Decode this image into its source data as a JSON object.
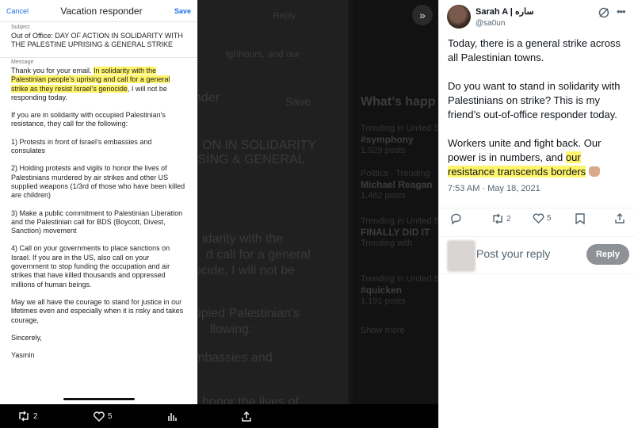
{
  "responder": {
    "cancel_label": "Cancel",
    "title": "Vacation responder",
    "save_label": "Save",
    "subject_label": "Subject",
    "subject": "Out of Office: DAY OF ACTION IN SOLIDARITY WITH THE PALESTINE UPRISING & GENERAL STRIKE",
    "message_label": "Message",
    "p1_pre": "Thank you for your email. ",
    "p1_hl": "In solidarity with the Palestinian people’s uprising and call for a general strike as they resist Israel’s genocide",
    "p1_post": ", I will not be responding today.",
    "p2": "If you are in solidarity with occupied Palestinian’s resistance, they call for the following:",
    "p3": "1) Protests in front of Israel’s embassies and consulates",
    "p4": "2) Holding protests and vigils to honor the lives of Palestinians murdered by air strikes and other US supplied weapons (1/3rd of those who have been killed are children)",
    "p5": "3) Make a public commitment to Palestinian Liberation and the Palestinian call for BDS (Boycott, Divest, Sanction) movement",
    "p6": "4) Call on your governments to place sanctions on Israel. If you are in the US, also call on your government to stop funding the occupation and air strikes that have killed thousands and oppressed millions of human beings.",
    "p7": "May we all have the courage to stand for justice in our lifetimes even and especially when it is risky and takes courage,",
    "p8": "Sincerely,",
    "p9": "Yasmin"
  },
  "background": {
    "reply": "Reply",
    "save": "Save",
    "bg_lines": [
      "ighhours, and our",
      "nder",
      "ON IN SOLIDARITY",
      "ISING & GENERAL",
      "idarity with the",
      "d call for a general",
      "ocide, I will not be",
      "upied Palestinian's",
      "llowing:",
      "mbassies and",
      "honor the lives of",
      "ered by air strikes and other US"
    ],
    "trends_title": "What’s happ",
    "trends": [
      {
        "meta": "Trending in United St",
        "name": "#symphony",
        "count": "1,929 posts"
      },
      {
        "meta": "Politics · Trending",
        "name": "Michael Reagan",
        "count": "1,462 posts"
      },
      {
        "meta": "Trending in United Sta",
        "name": "FINALLY DID IT",
        "count": "Trending with"
      },
      {
        "meta": "Trending in United Sta",
        "name": "#quicken",
        "count": "1,191 posts"
      }
    ],
    "show_more": "Show more"
  },
  "bottom_bar": {
    "retweets": "2",
    "likes": "5"
  },
  "tweet": {
    "name": "Sarah A | ساره",
    "handle": "@sa0un",
    "para1": "Today, there is a general strike across all Palestinian towns.",
    "para2": "Do you want to stand in solidarity with Palestinians on strike? This is my friend’s out-of-office responder today.",
    "para3_pre": "Workers unite and fight back. Our power is in numbers, and ",
    "para3_hl": "our resistance transcends borders",
    "timestamp": "7:53 AM · May 18, 2021",
    "retweets": "2",
    "likes": "5",
    "reply_placeholder": "Post your reply",
    "reply_button": "Reply"
  },
  "colors": {
    "highlight": "#fff46a",
    "link_blue": "#1a73e8"
  }
}
